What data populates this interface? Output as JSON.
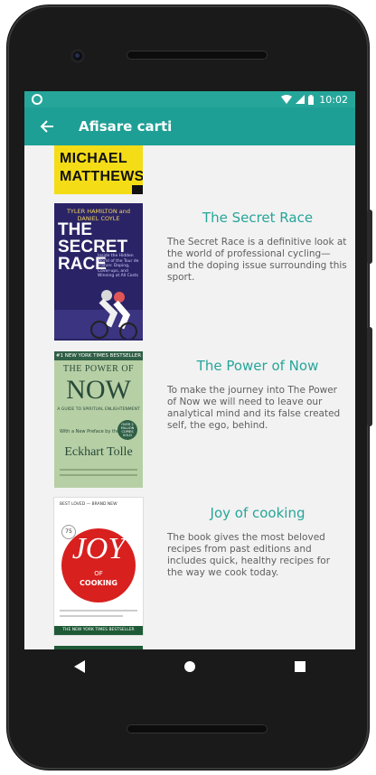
{
  "status_bar": {
    "time": "10:02"
  },
  "app_bar": {
    "title": "Afisare carti"
  },
  "books": [
    {
      "cover_lines": [
        "MICHAEL",
        "MATTHEWS"
      ]
    },
    {
      "title": "The Secret Race",
      "description": "The Secret Race is a definitive look at the world of professional cycling—and the doping issue surrounding this sport.",
      "cover": {
        "authors": "TYLER HAMILTON and DANIEL COYLE",
        "heading": "THE SECRET RACE",
        "tagline": "Inside the Hidden World of the Tour de France: Doping, Cover-ups, and Winning at All Costs"
      }
    },
    {
      "title": "The Power of Now",
      "description": "To make the journey into The Power of Now we will need to leave our analytical mind and its false created self, the ego, behind.",
      "cover": {
        "banner": "#1 NEW YORK TIMES BESTSELLER",
        "line1": "THE POWER OF",
        "line2": "NOW",
        "subtitle": "A GUIDE TO SPIRITUAL ENLIGHTENMENT",
        "preface": "With a New Preface by the Author",
        "author": "Eckhart Tolle",
        "seal": "OVER 2 MILLION COPIES SOLD"
      }
    },
    {
      "title": "Joy of cooking",
      "description": "The book gives the most beloved recipes from past editions and includes quick, healthy recipes for the way we cook today.",
      "cover": {
        "top": "BEST LOVED — BRAND NEW",
        "badge": "75",
        "logo_joy": "JOY",
        "logo_of": "OF",
        "logo_cooking": "COOKING",
        "footer": "THE NEW YORK TIMES BESTSELLER"
      }
    }
  ],
  "colors": {
    "accent": "#26a69a",
    "status_bar": "#26a69a",
    "app_bar": "#1e9f95"
  }
}
